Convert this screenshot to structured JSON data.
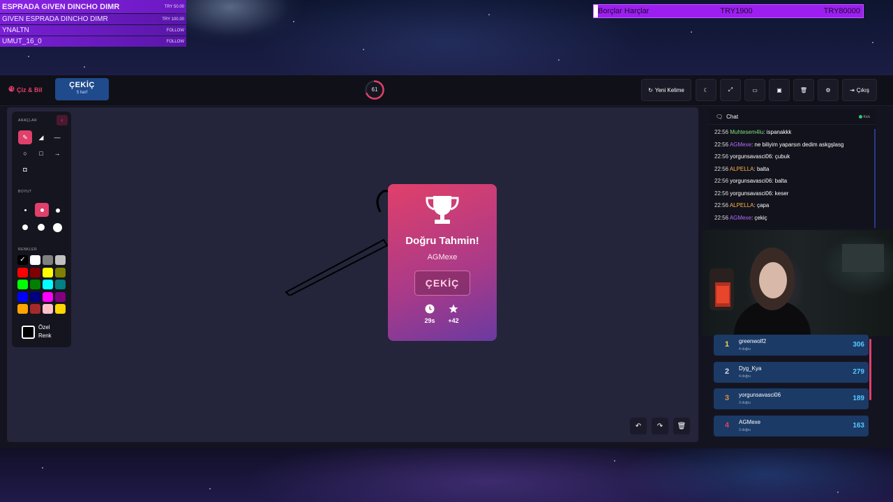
{
  "donations": [
    {
      "name": "ESPRADA GIVEN DINCHO DIMR",
      "amount": "TRY 50.00"
    },
    {
      "name": "GIVEN ESPRADA DINCHO DIMR",
      "amount": "TRY 100.00"
    },
    {
      "name": "YNALTN",
      "amount": "FOLLOW"
    },
    {
      "name": "UMUT_16_0",
      "amount": "FOLLOW"
    }
  ],
  "goal": {
    "label": "Borçlar Harçlar",
    "current": "TRY1900",
    "target": "TRY80000"
  },
  "app": {
    "brand": "Çiz & Bil"
  },
  "word": {
    "text": "ÇEKİÇ",
    "hint": "5 harf"
  },
  "timer": {
    "value": "61",
    "fraction": 0.68
  },
  "toolbar": {
    "new_word_label": "Yeni Kelime",
    "exit_label": "Çıkış",
    "icons": [
      "refresh-icon",
      "moon-icon",
      "fullscreen-icon",
      "window-icon",
      "archive-icon",
      "trash-icon",
      "gear-icon",
      "sign-out-icon"
    ]
  },
  "tools": {
    "section_label": "ARAÇLAR",
    "size_label": "BOYUT",
    "colors_label": "RENKLER",
    "custom_color_label_1": "Özel",
    "custom_color_label_2": "Renk",
    "palette": [
      "#000000",
      "#ffffff",
      "#808080",
      "#c0c0c0",
      "#ff0000",
      "#800000",
      "#ffff00",
      "#808000",
      "#00ff00",
      "#008000",
      "#00ffff",
      "#008080",
      "#0000ff",
      "#000080",
      "#ff00ff",
      "#800080",
      "#ffa500",
      "#a52a2a",
      "#ffc0cb",
      "#ffd700"
    ]
  },
  "result": {
    "title": "Doğru Tahmin!",
    "winner": "AGMexe",
    "answer": "ÇEKİÇ",
    "time": "29s",
    "points": "+42"
  },
  "chat": {
    "title": "Chat",
    "platform": "Kick",
    "messages": [
      {
        "time": "22:56",
        "user": "Muhtesem4lu",
        "color": "#7ee27e",
        "text": ": ispanakkk"
      },
      {
        "time": "22:56",
        "user": "AGMexe",
        "color": "#b46cff",
        "text": ": ne biliyim yaparsın dedim askgşlasg"
      },
      {
        "time": "22:56",
        "user": "yorgunsavasci06",
        "color": "#ffffff",
        "text": ": çubuk"
      },
      {
        "time": "22:56",
        "user": "ALPELLA",
        "color": "#ffb347",
        "text": ": balta"
      },
      {
        "time": "22:56",
        "user": "yorgunsavasci06",
        "color": "#ffffff",
        "text": ": balta"
      },
      {
        "time": "22:56",
        "user": "yorgunsavasci06",
        "color": "#ffffff",
        "text": ": keser"
      },
      {
        "time": "22:56",
        "user": "ALPELLA",
        "color": "#ffb347",
        "text": ": çapa"
      },
      {
        "time": "22:56",
        "user": "AGMexe",
        "color": "#b46cff",
        "text": ": çekiç"
      }
    ]
  },
  "leaderboard": [
    {
      "rank": "1",
      "name": "greenwolf2",
      "sub": "4 doğru",
      "score": "306",
      "rank_color": "#ffd23f"
    },
    {
      "rank": "2",
      "name": "Dyg_Kya",
      "sub": "4 doğru",
      "score": "279",
      "rank_color": "#d8dde8"
    },
    {
      "rank": "3",
      "name": "yorgunsavasci06",
      "sub": "3 doğru",
      "score": "189",
      "rank_color": "#e0903a"
    },
    {
      "rank": "4",
      "name": "AGMexe",
      "sub": "3 doğru",
      "score": "163",
      "rank_color": "#e0406a"
    }
  ]
}
